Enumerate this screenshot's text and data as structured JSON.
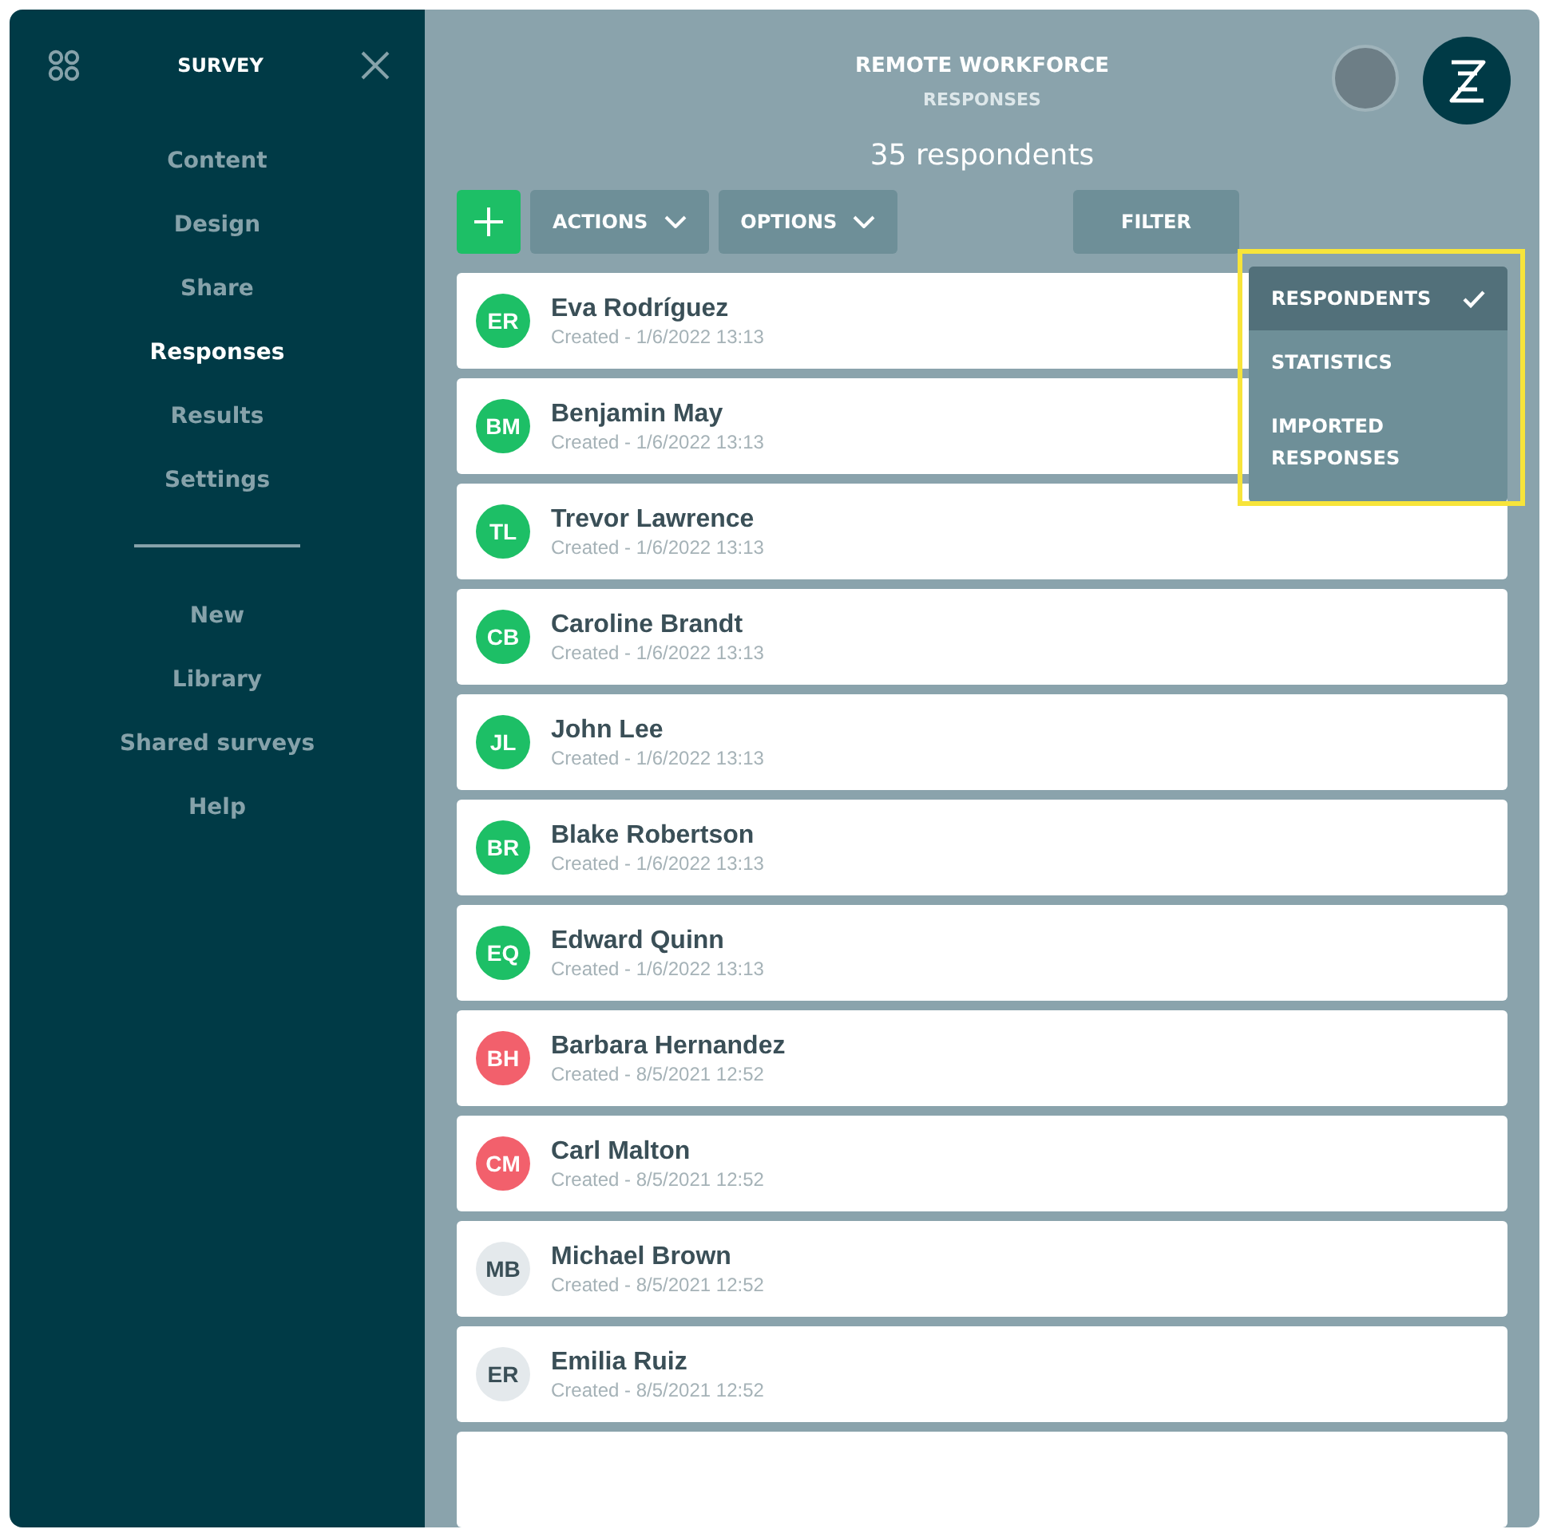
{
  "sidebar": {
    "title": "SURVEY",
    "items": [
      {
        "label": "Content",
        "selected": false
      },
      {
        "label": "Design",
        "selected": false
      },
      {
        "label": "Share",
        "selected": false
      },
      {
        "label": "Responses",
        "selected": true
      },
      {
        "label": "Results",
        "selected": false
      },
      {
        "label": "Settings",
        "selected": false
      }
    ],
    "secondary_items": [
      {
        "label": "New"
      },
      {
        "label": "Library"
      },
      {
        "label": "Shared surveys"
      },
      {
        "label": "Help"
      }
    ]
  },
  "header": {
    "title": "REMOTE WORKFORCE",
    "subtitle": "RESPONSES"
  },
  "count": "35 respondents",
  "toolbar": {
    "actions": "ACTIONS",
    "options": "OPTIONS",
    "filter": "FILTER"
  },
  "view_menu": {
    "highlighted": true,
    "items": [
      {
        "label": "RESPONDENTS",
        "selected": true
      },
      {
        "label": "STATISTICS",
        "selected": false
      },
      {
        "label": "IMPORTED RESPONSES",
        "selected": false
      }
    ]
  },
  "respondents": [
    {
      "initials": "ER",
      "name": "Eva Rodríguez",
      "created": "Created - 1/6/2022 13:13",
      "color": "#1dbf66"
    },
    {
      "initials": "BM",
      "name": "Benjamin May",
      "created": "Created - 1/6/2022 13:13",
      "color": "#1dbf66"
    },
    {
      "initials": "TL",
      "name": "Trevor Lawrence",
      "created": "Created - 1/6/2022 13:13",
      "color": "#1dbf66"
    },
    {
      "initials": "CB",
      "name": "Caroline Brandt",
      "created": "Created - 1/6/2022 13:13",
      "color": "#1dbf66"
    },
    {
      "initials": "JL",
      "name": "John Lee",
      "created": "Created - 1/6/2022 13:13",
      "color": "#1dbf66"
    },
    {
      "initials": "BR",
      "name": "Blake Robertson",
      "created": "Created - 1/6/2022 13:13",
      "color": "#1dbf66"
    },
    {
      "initials": "EQ",
      "name": "Edward Quinn",
      "created": "Created - 1/6/2022 13:13",
      "color": "#1dbf66"
    },
    {
      "initials": "BH",
      "name": "Barbara Hernandez",
      "created": "Created - 8/5/2021 12:52",
      "color": "#f2606c"
    },
    {
      "initials": "CM",
      "name": "Carl Malton",
      "created": "Created - 8/5/2021 12:52",
      "color": "#f2606c"
    },
    {
      "initials": "MB",
      "name": "Michael Brown",
      "created": "Created - 8/5/2021 12:52",
      "color": "#e4e9ec"
    },
    {
      "initials": "ER",
      "name": "Emilia Ruiz",
      "created": "Created - 8/5/2021 12:52",
      "color": "#e4e9ec"
    }
  ]
}
